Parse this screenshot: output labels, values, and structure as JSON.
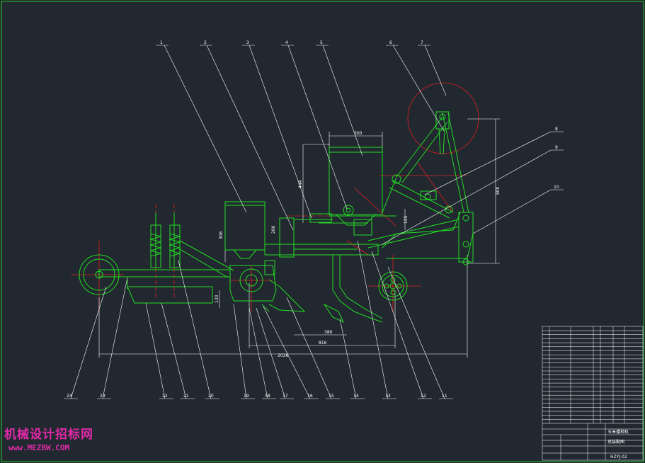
{
  "drawing": {
    "part_numbers": [
      "1",
      "2",
      "3",
      "4",
      "5",
      "6",
      "7",
      "8",
      "9",
      "10",
      "11",
      "12",
      "13",
      "14",
      "15",
      "16",
      "17",
      "18",
      "19",
      "20",
      "21",
      "22",
      "23",
      "24"
    ],
    "dimensions": {
      "hopper_width": "300",
      "hopper_height": "444",
      "frame_height": "800",
      "dim_125": "125",
      "dim_280": "280",
      "dim_306": "306",
      "dim_120": "120",
      "dim_380": "380",
      "dim_816": "816",
      "total_length": "2036"
    }
  },
  "title_block": {
    "title_line1": "玉米播种机",
    "title_line2": "总装配图",
    "drawing_no": "HZYJ-02"
  },
  "watermark": {
    "cn": "机械设计招标网",
    "url": "www.MEZBW.COM"
  },
  "colors": {
    "background": "#212830",
    "border": "#1fd11f",
    "part_lines": "#22dd22",
    "center_lines": "#e02020",
    "leader_lines": "#ffffff",
    "watermark": "#e02aa8"
  }
}
